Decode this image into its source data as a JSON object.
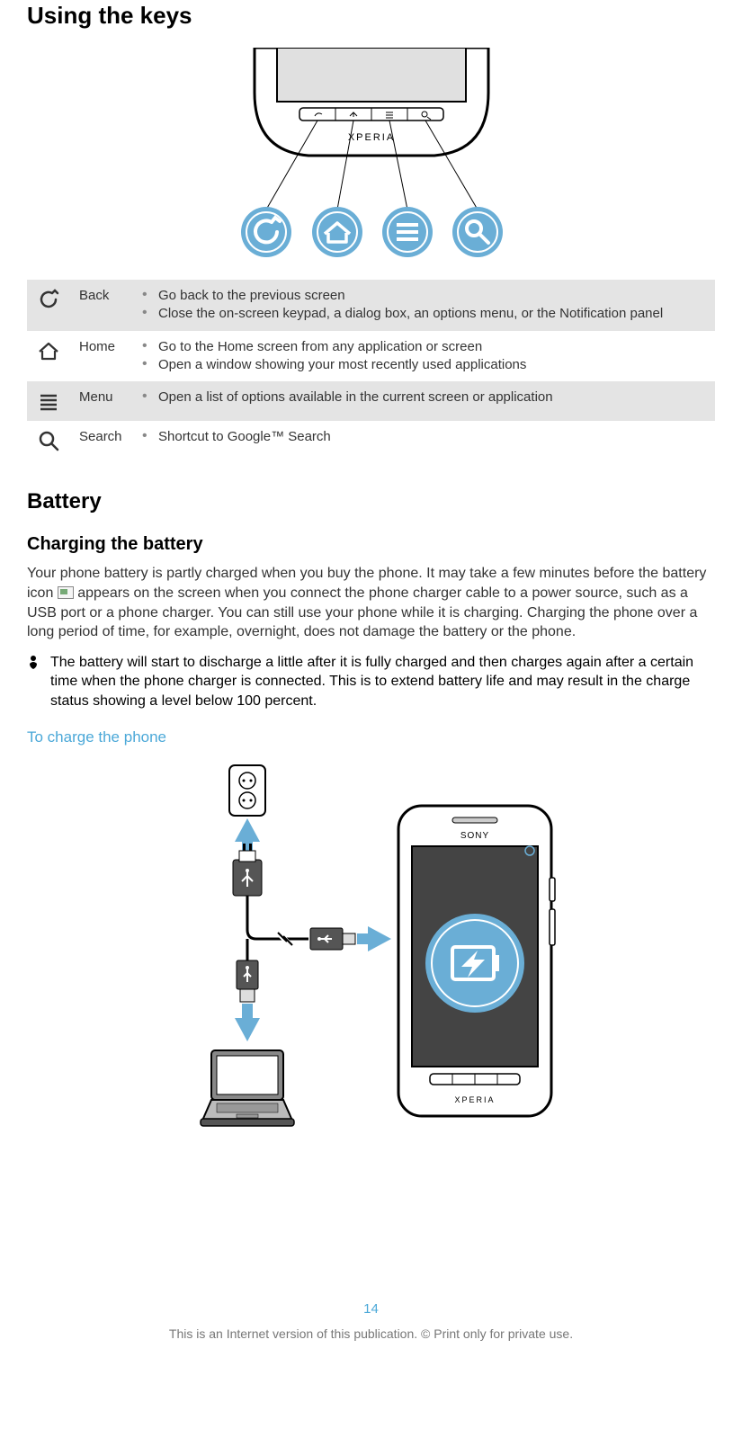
{
  "headings": {
    "using_keys": "Using the keys",
    "battery": "Battery",
    "charging": "Charging the battery",
    "to_charge": "To charge the phone"
  },
  "keys": {
    "back": {
      "label": "Back",
      "items": [
        "Go back to the previous screen",
        "Close the on-screen keypad, a dialog box, an options menu, or the Notification panel"
      ]
    },
    "home": {
      "label": "Home",
      "items": [
        "Go to the Home screen from any application or screen",
        "Open a window showing your most recently used applications"
      ]
    },
    "menu": {
      "label": "Menu",
      "items": [
        "Open a list of options available in the current screen or application"
      ]
    },
    "search": {
      "label": "Search",
      "items": [
        "Shortcut to Google™ Search"
      ]
    }
  },
  "paragraphs": {
    "charging_p1_a": "Your phone battery is partly charged when you buy the phone. It may take a few minutes before the battery icon ",
    "charging_p1_b": " appears on the screen when you connect the phone charger cable to a power source, such as a USB port or a phone charger. You can still use your phone while it is charging. Charging the phone over a long period of time, for example, overnight, does not damage the battery or the phone.",
    "note": "The battery will start to discharge a little after it is fully charged and then charges again after a certain time when the phone charger is connected. This is to extend battery life and may result in the charge status showing a level below 100 percent."
  },
  "page_number": "14",
  "footer": "This is an Internet version of this publication. © Print only for private use.",
  "brand": {
    "xperia": "XPERIA",
    "sony": "SONY"
  }
}
